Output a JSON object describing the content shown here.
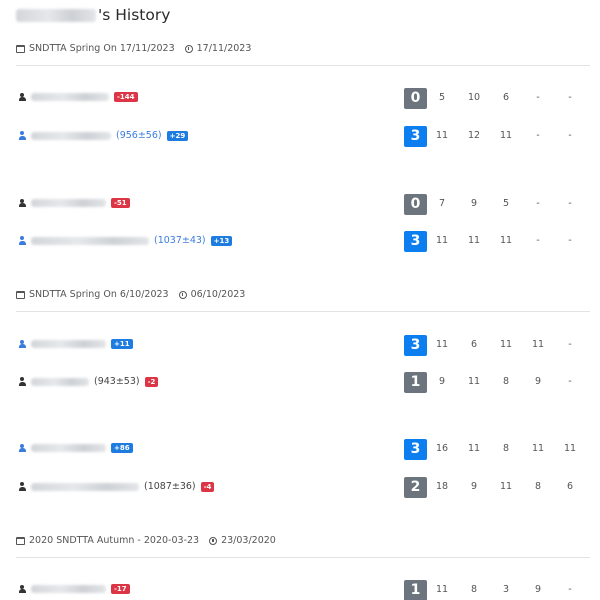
{
  "page": {
    "title_suffix": "'s History"
  },
  "events": [
    {
      "name": "SNDTTA Spring On 17/11/2023",
      "date": "17/11/2023",
      "matches": [
        {
          "players": [
            {
              "color": "black",
              "rating": "",
              "delta": "-144",
              "delta_sign": "neg",
              "score": "0",
              "games": [
                "5",
                "10",
                "6",
                "-",
                "-"
              ]
            },
            {
              "color": "blue",
              "rating": "(956±56)",
              "delta": "+29",
              "delta_sign": "pos",
              "score": "3",
              "games": [
                "11",
                "12",
                "11",
                "-",
                "-"
              ]
            }
          ]
        },
        {
          "players": [
            {
              "color": "black",
              "rating": "",
              "delta": "-51",
              "delta_sign": "neg",
              "score": "0",
              "games": [
                "7",
                "9",
                "5",
                "-",
                "-"
              ]
            },
            {
              "color": "blue",
              "rating": "(1037±43)",
              "delta": "+13",
              "delta_sign": "pos",
              "score": "3",
              "games": [
                "11",
                "11",
                "11",
                "-",
                "-"
              ]
            }
          ]
        }
      ]
    },
    {
      "name": "SNDTTA Spring On 6/10/2023",
      "date": "06/10/2023",
      "matches": [
        {
          "players": [
            {
              "color": "blue",
              "rating": "",
              "delta": "+11",
              "delta_sign": "pos",
              "score": "3",
              "games": [
                "11",
                "6",
                "11",
                "11",
                "-"
              ]
            },
            {
              "color": "black",
              "rating": "(943±53)",
              "delta": "-2",
              "delta_sign": "neg",
              "score": "1",
              "games": [
                "9",
                "11",
                "8",
                "9",
                "-"
              ]
            }
          ]
        },
        {
          "players": [
            {
              "color": "blue",
              "rating": "",
              "delta": "+86",
              "delta_sign": "pos",
              "score": "3",
              "games": [
                "16",
                "11",
                "8",
                "11",
                "11"
              ]
            },
            {
              "color": "black",
              "rating": "(1087±36)",
              "delta": "-4",
              "delta_sign": "neg",
              "score": "2",
              "games": [
                "18",
                "9",
                "11",
                "8",
                "6"
              ]
            }
          ]
        }
      ]
    },
    {
      "name": "2020 SNDTTA Autumn - 2020-03-23",
      "date": "23/03/2020",
      "matches": [
        {
          "players": [
            {
              "color": "black",
              "rating": "",
              "delta": "-17",
              "delta_sign": "neg",
              "score": "1",
              "games": [
                "11",
                "8",
                "3",
                "9",
                "-"
              ]
            }
          ]
        }
      ]
    }
  ]
}
